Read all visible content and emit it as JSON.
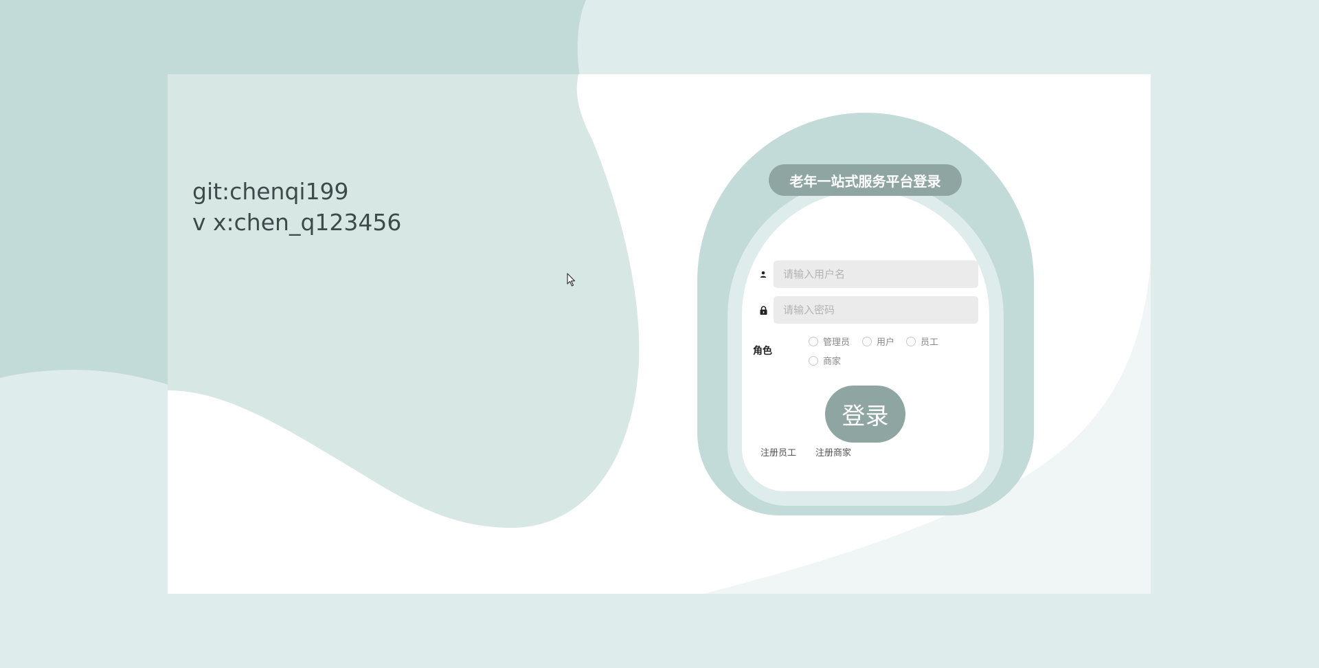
{
  "credits": {
    "line1": "git:chenqi199",
    "line2": "v x:chen_q123456"
  },
  "login": {
    "title": "老年一站式服务平台登录",
    "username_placeholder": "请输入用户名",
    "password_placeholder": "请输入密码",
    "role_label": "角色",
    "roles": [
      "管理员",
      "用户",
      "员工",
      "商家"
    ],
    "login_button": "登录",
    "register_links": [
      "注册员工",
      "注册商家"
    ]
  },
  "icons": {
    "user": "user-icon",
    "lock": "lock-icon",
    "cursor": "mouse-cursor-icon"
  },
  "colors": {
    "page_bg": "#deeceb",
    "blob": "#c3dbd8",
    "accent": "#8fa5a2",
    "card": "#ffffff",
    "input_bg": "#ebebeb"
  }
}
